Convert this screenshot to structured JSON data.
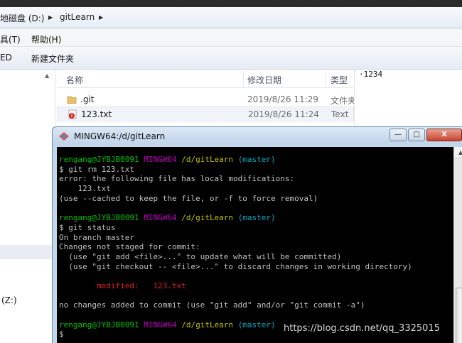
{
  "explorer": {
    "address": {
      "drive": "地磁盘 (D:)",
      "sep1": "▶",
      "folder": "gitLearn",
      "sep2": "▶"
    },
    "menu": {
      "tools": "具(T)",
      "help": "帮助(H)"
    },
    "commands": {
      "print": "ED",
      "new_folder": "新建文件夹"
    },
    "nav": {
      "drive_z": "(Z:)"
    },
    "columns": {
      "name": "名称",
      "date": "修改日期",
      "type": "类型"
    },
    "files": [
      {
        "name": ".git",
        "date": "2019/8/26 11:29",
        "type": "文件夹"
      },
      {
        "name": "123.txt",
        "date": "2019/8/26 11:24",
        "type": "Text"
      }
    ],
    "preview_text": "·1234"
  },
  "mingw": {
    "title": "MINGW64:/d/gitLearn",
    "buttons": {
      "minimize": "—",
      "maximize": "□",
      "close": "X"
    },
    "prompt": {
      "user": "rengang@JYBJB0091",
      "sys": "MINGW64",
      "path": "/d/gitLearn",
      "branch": "(master)"
    },
    "lines": [
      "$ git rm 123.txt",
      "error: the following file has local modifications:",
      "    123.txt",
      "(use --cached to keep the file, or -f to force removal)",
      "$ git status",
      "On branch master",
      "Changes not staged for commit:",
      "  (use \"git add <file>...\" to update what will be committed)",
      "  (use \"git checkout -- <file>...\" to discard changes in working directory)",
      "        modified:   123.txt",
      "no changes added to commit (use \"git add\" and/or \"git commit -a\")",
      "$"
    ]
  },
  "watermark": "https://blog.csdn.net/qq_3325015"
}
